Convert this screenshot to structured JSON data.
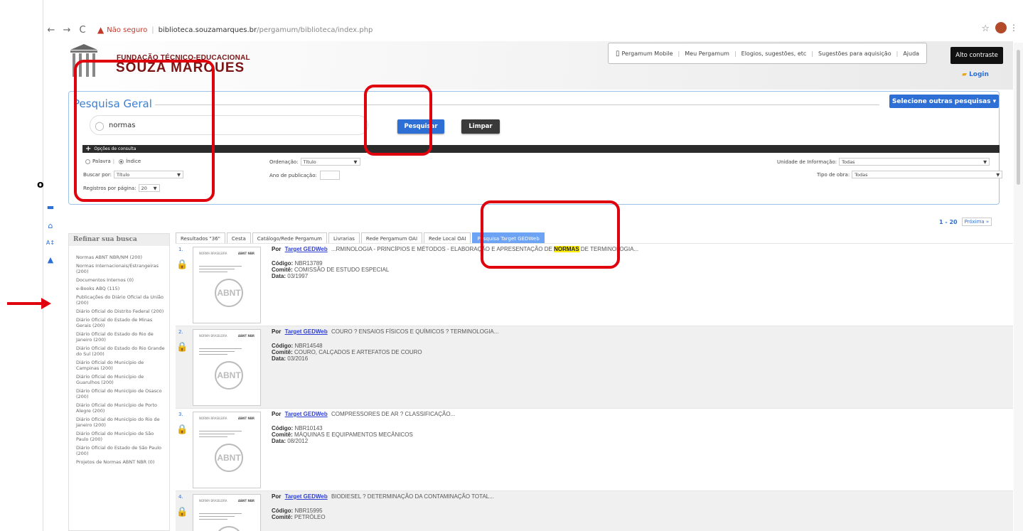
{
  "browser": {
    "insecure_label": "Não seguro",
    "url_host": "biblioteca.souzamarques.br",
    "url_path": "/pergamum/biblioteca/index.php"
  },
  "header": {
    "logo_line1": "FUNDAÇÃO TÉCNICO-EDUCACIONAL",
    "logo_line2": "SOUZA MARQUES",
    "links": [
      "Pergamum Mobile",
      "Meu Pergamum",
      "Elogios, sugestões, etc",
      "Sugestões para aquisição",
      "Ajuda"
    ],
    "contrast": "Alto contraste",
    "login": "Login"
  },
  "search": {
    "title": "Pesquisa Geral",
    "select_others": "Selecione outras pesquisas",
    "query": "normas",
    "search_btn": "Pesquisar",
    "clear_btn": "Limpar",
    "options_label": "Opções de consulta",
    "palavra": "Palavra",
    "indice": "Índice",
    "buscar_por_label": "Buscar por:",
    "buscar_por_value": "Título",
    "registros_label": "Registros por página:",
    "registros_value": "20",
    "ordenacao_label": "Ordenação:",
    "ordenacao_value": "Título",
    "ano_label": "Ano de publicação:",
    "unidade_label": "Unidade de Informação:",
    "unidade_value": "Todas",
    "tipo_label": "Tipo de obra:",
    "tipo_value": "Todas"
  },
  "pagination": {
    "range": "1 - 20",
    "next": "Próxima »"
  },
  "tabs": [
    "Resultados \"36\"",
    "Cesta",
    "Catálogo/Rede Pergamum",
    "Livrarias",
    "Rede Pergamum OAI",
    "Rede Local OAI",
    "Pesquisa Target GEDWeb"
  ],
  "refine": {
    "title": "Refinar sua busca",
    "items": [
      "Normas ABNT NBR/NM (200)",
      "Normas Internacionais/Estrangeiras (200)",
      "Documentos Internos (0)",
      "e-Books ABQ (115)",
      "Publicações do Diário Oficial da União (200)",
      "Diário Oficial do Distrito Federal (200)",
      "Diário Oficial do Estado de Minas Gerais (200)",
      "Diário Oficial do Estado do Rio de Janeiro (200)",
      "Diário Oficial do Estado do Rio Grande do Sul (200)",
      "Diário Oficial do Município de Campinas (200)",
      "Diário Oficial do Município de Guarulhos (200)",
      "Diário Oficial do Município de Osasco (200)",
      "Diário Oficial do Município de Porto Alegre (200)",
      "Diário Oficial do Município do Rio de Janeiro (200)",
      "Diário Oficial do Município de São Paulo (200)",
      "Diário Oficial do Estado de São Paulo (200)",
      "Projetos de Normas ABNT NBR (0)"
    ]
  },
  "results_common": {
    "por": "Por",
    "link": "Target GEDWeb",
    "codigo_label": "Código:",
    "comite_label": "Comitê:",
    "data_label": "Data:"
  },
  "results": [
    {
      "num": "1.",
      "title_pre": "...RMINOLOGIA - PRINCÍPIOS E MÉTODOS - ELABORAÇÃO E APRESENTAÇÃO DE",
      "highlight": "NORMAS",
      "title_post": "DE TERMINOLOGIA...",
      "codigo": "NBR13789",
      "comite": "COMISSÃO DE ESTUDO ESPECIAL",
      "data": "03/1997"
    },
    {
      "num": "2.",
      "title_pre": "COURO ? ENSAIOS FÍSICOS E QUÍMICOS ? TERMINOLOGIA...",
      "highlight": "",
      "title_post": "",
      "codigo": "NBR14548",
      "comite": "COURO, CALÇADOS E ARTEFATOS DE COURO",
      "data": "03/2016"
    },
    {
      "num": "3.",
      "title_pre": "COMPRESSORES DE AR ? CLASSIFICAÇÃO...",
      "highlight": "",
      "title_post": "",
      "codigo": "NBR10143",
      "comite": "MÁQUINAS E EQUIPAMENTOS MECÂNICOS",
      "data": "08/2012"
    },
    {
      "num": "4.",
      "title_pre": "BIODIESEL ? DETERMINAÇÃO DA CONTAMINAÇÃO TOTAL...",
      "highlight": "",
      "title_post": "",
      "codigo": "NBR15995",
      "comite": "PETRÓLEO",
      "data": ""
    }
  ],
  "thumb_text": {
    "norma": "NORMA BRASILEIRA",
    "abnt": "ABNT NBR",
    "abnt_logo": "ABNT"
  }
}
